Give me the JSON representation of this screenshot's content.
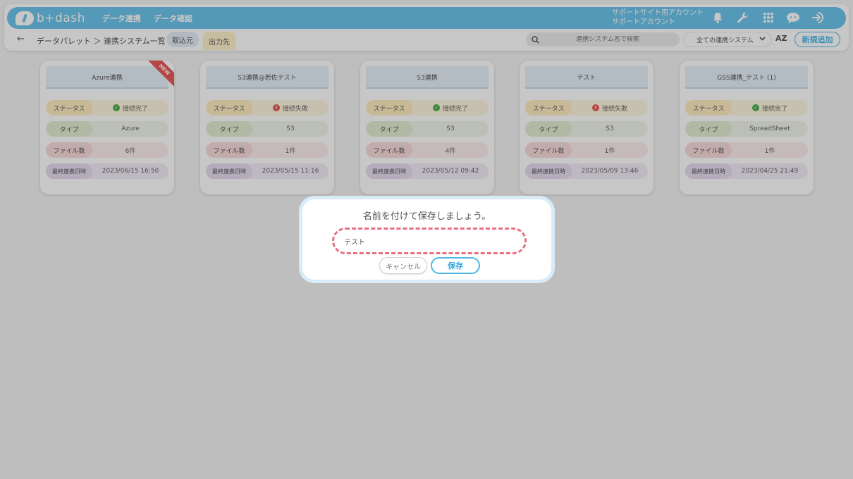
{
  "header": {
    "logo_text": "b+dash",
    "nav": [
      "データ連携",
      "データ確認"
    ],
    "account_line1": "サポートサイト用アカウント",
    "account_line2": "サポートアカウント"
  },
  "subbar": {
    "back": "←",
    "breadcrumb": "データパレット ＞ 連携システム一覧",
    "tab_in": "取込元",
    "tab_out": "出力先",
    "search_placeholder": "連携システム名で検索",
    "filter_value": "全ての連携システム",
    "sort_label": "AZ",
    "add_button": "新規追加"
  },
  "card_labels": {
    "status": "ステータス",
    "type": "タイプ",
    "files": "ファイル数",
    "last_sync": "最終連携日時"
  },
  "cards": [
    {
      "title": "Azure連携",
      "badge": "NEW",
      "status": "接続完了",
      "status_ok": true,
      "type": "Azure",
      "files": "6件",
      "last_sync": "2023/06/15 16:50"
    },
    {
      "title": "S3連携@若佐テスト",
      "status": "接続失敗",
      "status_ok": false,
      "type": "S3",
      "files": "1件",
      "last_sync": "2023/05/15 11:16"
    },
    {
      "title": "S3連携",
      "status": "接続完了",
      "status_ok": true,
      "type": "S3",
      "files": "4件",
      "last_sync": "2023/05/12 09:42"
    },
    {
      "title": "テスト",
      "status": "接続失敗",
      "status_ok": false,
      "type": "S3",
      "files": "1件",
      "last_sync": "2023/05/09 13:46"
    },
    {
      "title": "GSS連携_テスト (1)",
      "status": "接続完了",
      "status_ok": true,
      "type": "SpreadSheet",
      "files": "1件",
      "last_sync": "2023/04/25 21:49"
    }
  ],
  "dialog": {
    "title": "名前を付けて保存しましょう。",
    "input_value": "テスト",
    "cancel": "キャンセル",
    "save": "保存"
  },
  "colors": {
    "brand": "#6cc6ec",
    "accent": "#4fb6e6",
    "highlight_dash": "#e86f82"
  }
}
